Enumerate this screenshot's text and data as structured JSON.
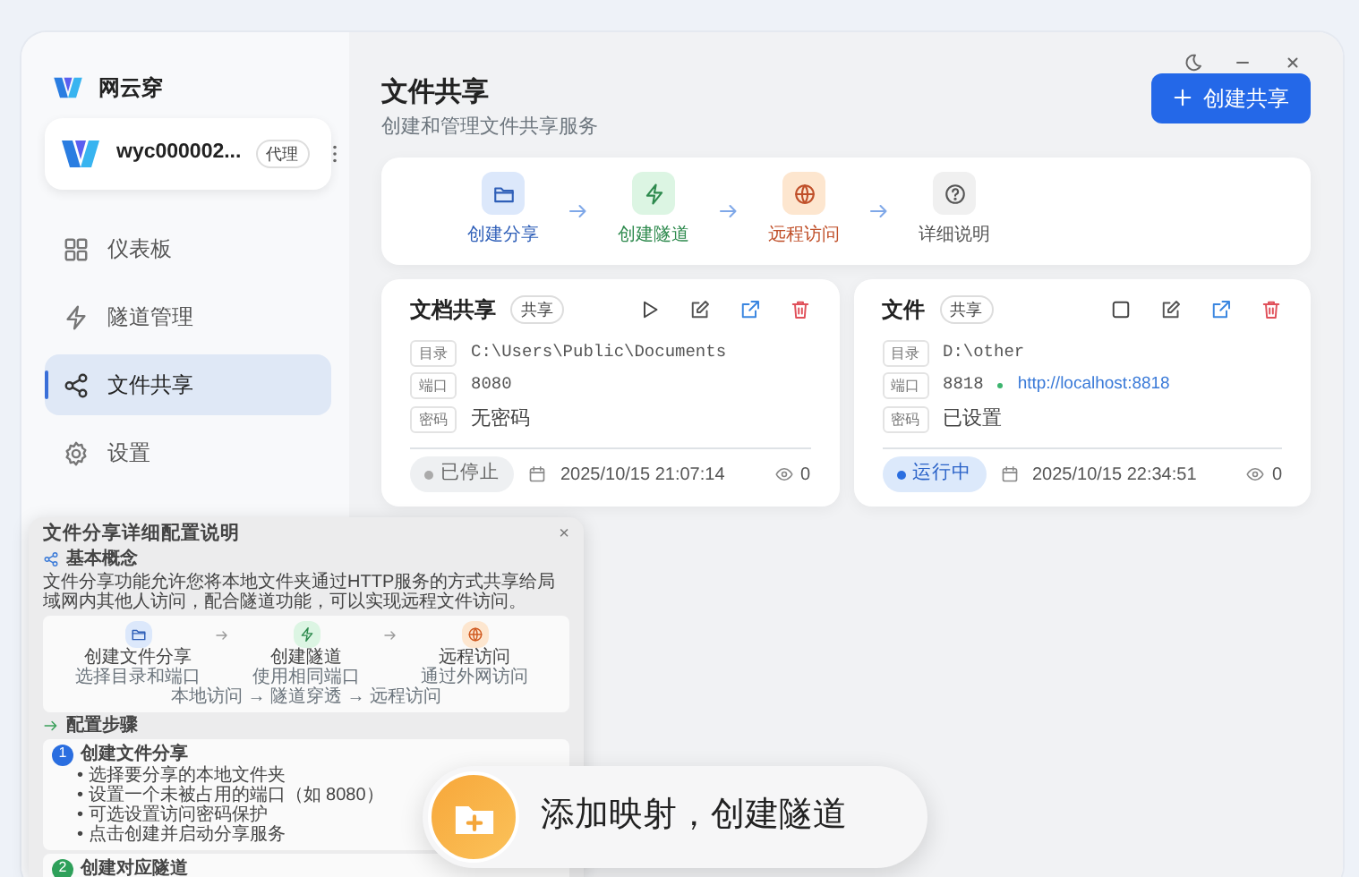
{
  "app": {
    "name": "网云穿"
  },
  "user": {
    "name": "wyc000002...",
    "badge": "代理"
  },
  "sidebar": {
    "items": [
      {
        "label": "仪表板",
        "selected": false
      },
      {
        "label": "隧道管理",
        "selected": false
      },
      {
        "label": "文件共享",
        "selected": true
      },
      {
        "label": "设置",
        "selected": false
      }
    ]
  },
  "header": {
    "title": "文件共享",
    "subtitle": "创建和管理文件共享服务",
    "button": "创建共享"
  },
  "steps": [
    {
      "label": "创建分享",
      "color": "#2f5fb8"
    },
    {
      "label": "创建隧道",
      "color": "#2e8a4e"
    },
    {
      "label": "远程访问",
      "color": "#c0502a"
    },
    {
      "label": "详细说明",
      "color": "#555555"
    }
  ],
  "shares": [
    {
      "name": "文档共享",
      "tag": "共享",
      "running": false,
      "fields": [
        {
          "label": "目录",
          "value": "C:\\Users\\Public\\Documents",
          "kind": "mono"
        },
        {
          "label": "端口",
          "value": "8080",
          "kind": "mono"
        },
        {
          "label": "密码",
          "value": "无密码",
          "kind": "text"
        }
      ],
      "status": "已停止",
      "created": "2025/10/15 21:07:14",
      "views": "0"
    },
    {
      "name": "文件",
      "tag": "共享",
      "running": true,
      "fields": [
        {
          "label": "目录",
          "value": "D:\\other",
          "kind": "mono"
        },
        {
          "label": "端口",
          "value": "8818",
          "kind": "mono",
          "url": "http://localhost:8818"
        },
        {
          "label": "密码",
          "value": "已设置",
          "kind": "text"
        }
      ],
      "status": "运行中",
      "created": "2025/10/15 22:34:51",
      "views": "0"
    }
  ],
  "guide_panel": {
    "title": "文件分享详细配置说明",
    "close": "×",
    "concept_heading": "基本概念",
    "concept_text": "文件分享功能允许您将本地文件夹通过HTTP服务的方式共享给局域网内其他人访问，配合隧道功能，可以实现远程文件访问。",
    "flow": [
      {
        "label": "创建文件分享",
        "sub": "选择目录和端口"
      },
      {
        "label": "创建隧道",
        "sub": "使用相同端口"
      },
      {
        "label": "远程访问",
        "sub": "通过外网访问"
      }
    ],
    "flow_caption": "本地访问 → 隧道穿透 → 远程访问",
    "steps_heading": "配置步骤",
    "steps": [
      {
        "number": "1",
        "title": "创建文件分享",
        "bullets": [
          "• 选择要分享的本地文件夹",
          "• 设置一个未被占用的端口（如 8080）",
          "• 可选设置访问密码保护",
          "• 点击创建并启动分享服务"
        ]
      },
      {
        "number": "2",
        "title": "创建对应隧道"
      }
    ]
  },
  "toast": {
    "text": "添加映射，创建隧道"
  }
}
